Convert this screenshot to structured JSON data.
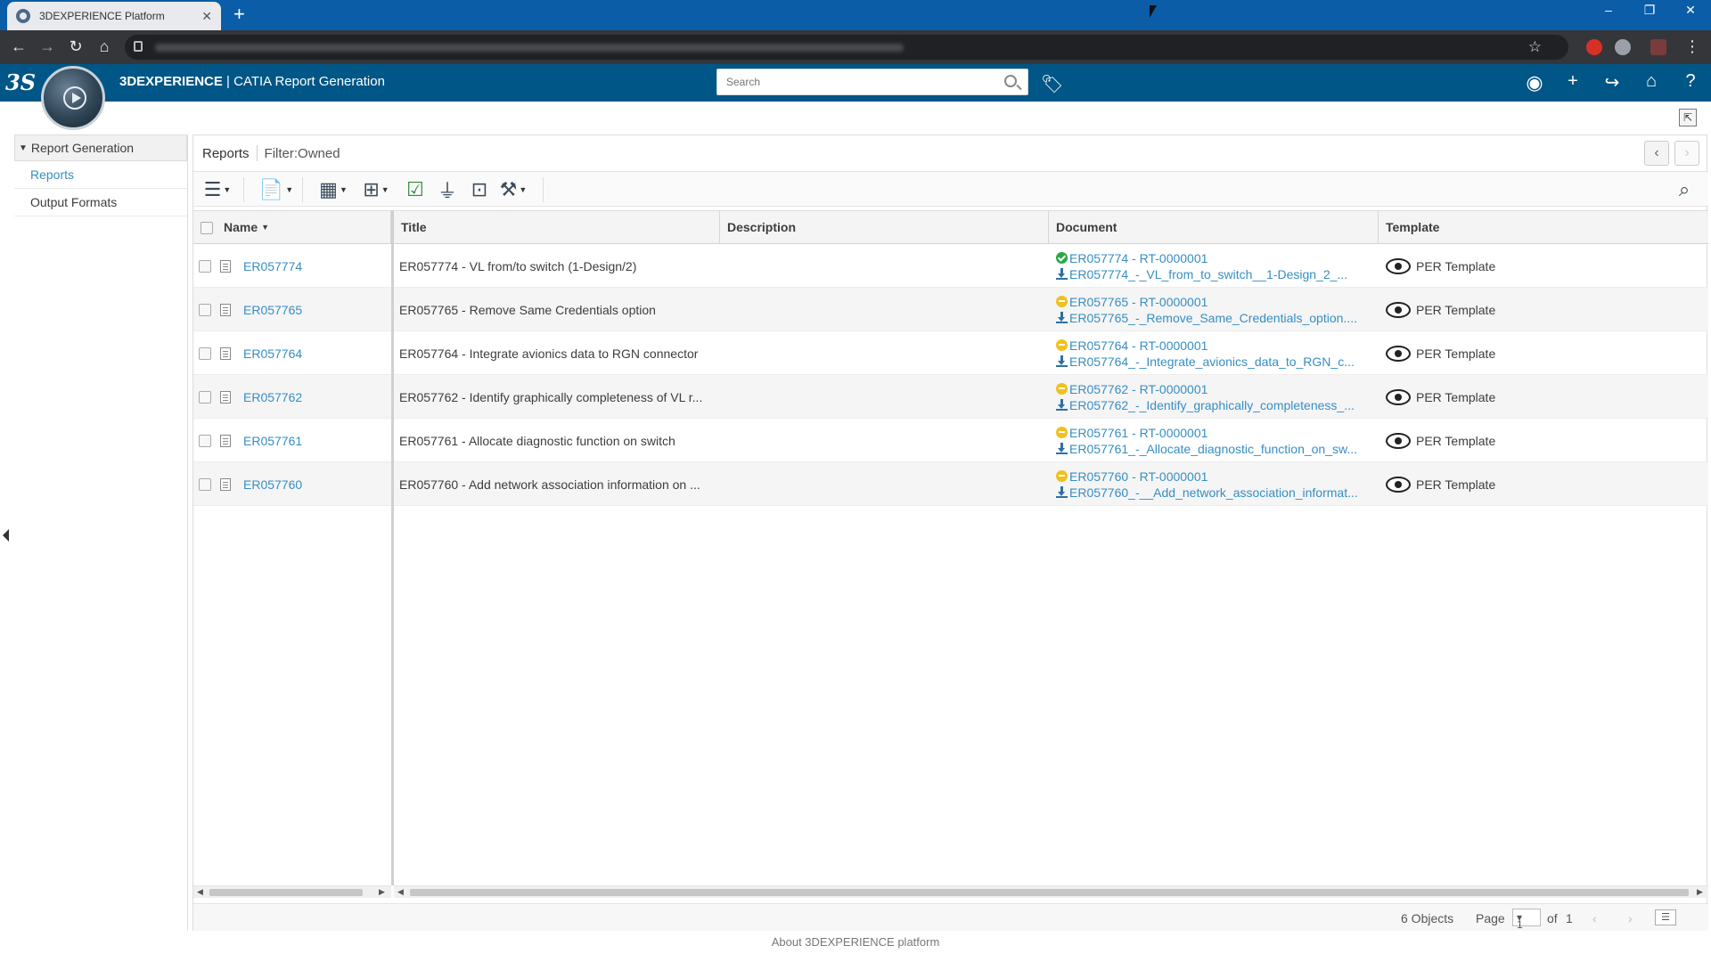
{
  "browser": {
    "tab_title": "3DEXPERIENCE Platform",
    "new_tab": "+",
    "min": "–",
    "restore": "❐",
    "close": "✕"
  },
  "header": {
    "logo": "3S",
    "brand": "3DEXPERIENCE",
    "app": " | CATIA  Report Generation",
    "search_placeholder": "Search"
  },
  "left": {
    "title": "Report Generation",
    "items": [
      "Reports",
      "Output Formats"
    ]
  },
  "main": {
    "crumb": "Reports",
    "filter": "Filter:Owned",
    "columns": [
      "Name",
      "Title",
      "Description",
      "Document",
      "Template"
    ],
    "rows": [
      {
        "name": "ER057774",
        "title": "ER057774 - VL from/to switch (1-Design/2)",
        "doc_ref": "ER057774 - RT-0000001",
        "doc_file": "ER057774_-_VL_from_to_switch__1-Design_2_...",
        "state": "ok",
        "template": "PER Template"
      },
      {
        "name": "ER057765",
        "title": "ER057765 - Remove Same Credentials option",
        "doc_ref": "ER057765 - RT-0000001",
        "doc_file": "ER057765_-_Remove_Same_Credentials_option....",
        "state": "wip",
        "template": "PER Template"
      },
      {
        "name": "ER057764",
        "title": "ER057764 - Integrate avionics data to RGN connector",
        "doc_ref": "ER057764 - RT-0000001",
        "doc_file": "ER057764_-_Integrate_avionics_data_to_RGN_c...",
        "state": "wip",
        "template": "PER Template"
      },
      {
        "name": "ER057762",
        "title": "ER057762 - Identify graphically completeness of VL r...",
        "doc_ref": "ER057762 - RT-0000001",
        "doc_file": "ER057762_-_Identify_graphically_completeness_...",
        "state": "wip",
        "template": "PER Template"
      },
      {
        "name": "ER057761",
        "title": "ER057761 - Allocate diagnostic function on switch",
        "doc_ref": "ER057761 - RT-0000001",
        "doc_file": "ER057761_-_Allocate_diagnostic_function_on_sw...",
        "state": "wip",
        "template": "PER Template"
      },
      {
        "name": "ER057760",
        "title": "ER057760 - Add network association information on ...",
        "doc_ref": "ER057760 - RT-0000001",
        "doc_file": "ER057760_-__Add_network_association_informat...",
        "state": "wip",
        "template": "PER Template"
      }
    ]
  },
  "footer": {
    "objects": "6 Objects",
    "page_label": "Page",
    "page_value": "1",
    "of_label": "of",
    "of_value": "1",
    "about": "About 3DEXPERIENCE platform"
  },
  "colors": {
    "header": "#005686",
    "tabstrip": "#0b5da8",
    "link": "#368ec4"
  }
}
